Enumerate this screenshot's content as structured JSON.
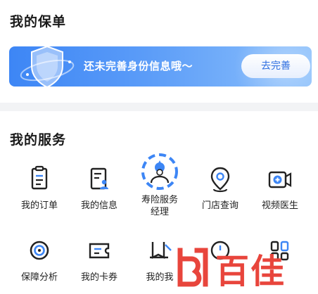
{
  "policy": {
    "title": "我的保单",
    "banner_text": "还未完善身份信息哦～",
    "banner_button": "去完善"
  },
  "services": {
    "title": "我的服务",
    "items": [
      {
        "label": "我的订单",
        "icon": "order-icon"
      },
      {
        "label": "我的信息",
        "icon": "personal-info-icon"
      },
      {
        "label": "寿险服务经理",
        "icon": "service-manager-avatar"
      },
      {
        "label": "门店查询",
        "icon": "location-pin-icon"
      },
      {
        "label": "视频医生",
        "icon": "video-doctor-icon"
      },
      {
        "label": "保障分析",
        "icon": "target-icon"
      },
      {
        "label": "我的卡券",
        "icon": "coupon-icon"
      },
      {
        "label": "我的我",
        "icon": "book-icon"
      },
      {
        "label": "",
        "icon": "clock-icon"
      },
      {
        "label": "",
        "icon": "apps-icon"
      }
    ]
  },
  "watermark": {
    "text": "百佳"
  },
  "colors": {
    "accent": "#3d86f5",
    "text": "#1f1f1f",
    "icon": "#222222",
    "watermark": "#e8453c"
  }
}
